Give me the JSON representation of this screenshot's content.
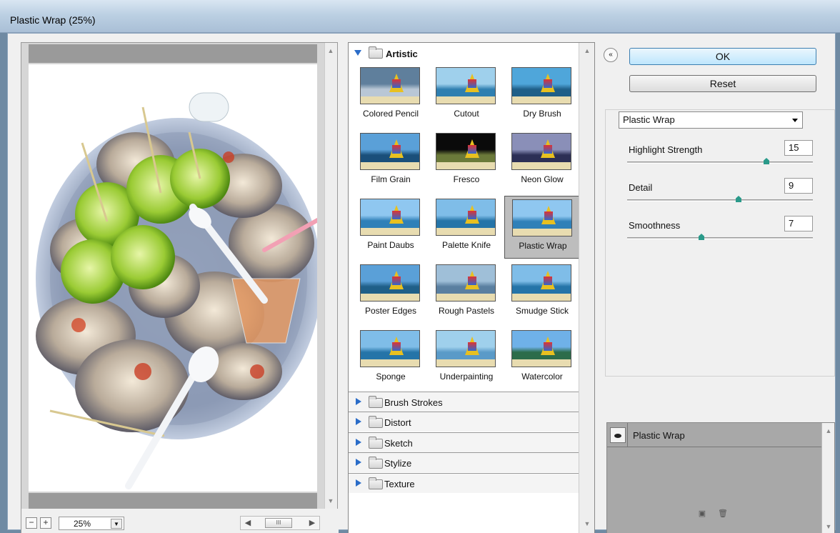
{
  "window": {
    "title": "Plastic Wrap (25%)"
  },
  "preview": {
    "zoom_value": "25%",
    "zoom_out_label": "−",
    "zoom_in_label": "+",
    "hscroll_thumb": "III"
  },
  "gallery": {
    "open_category": "Artistic",
    "filters": [
      {
        "label": "Colored Pencil"
      },
      {
        "label": "Cutout"
      },
      {
        "label": "Dry Brush"
      },
      {
        "label": "Film Grain"
      },
      {
        "label": "Fresco"
      },
      {
        "label": "Neon Glow"
      },
      {
        "label": "Paint Daubs"
      },
      {
        "label": "Palette Knife"
      },
      {
        "label": "Plastic Wrap"
      },
      {
        "label": "Poster Edges"
      },
      {
        "label": "Rough Pastels"
      },
      {
        "label": "Smudge Stick"
      },
      {
        "label": "Sponge"
      },
      {
        "label": "Underpainting"
      },
      {
        "label": "Watercolor"
      }
    ],
    "selected_filter": "Plastic Wrap",
    "collapsed_categories": [
      {
        "label": "Brush Strokes"
      },
      {
        "label": "Distort"
      },
      {
        "label": "Sketch"
      },
      {
        "label": "Stylize"
      },
      {
        "label": "Texture"
      }
    ]
  },
  "actions": {
    "ok_label": "OK",
    "reset_label": "Reset",
    "collapse_label": "«"
  },
  "settings": {
    "selected_filter": "Plastic Wrap",
    "params": [
      {
        "label": "Highlight Strength",
        "value": "15",
        "level": 0.75
      },
      {
        "label": "Detail",
        "value": "9",
        "level": 0.6
      },
      {
        "label": "Smoothness",
        "value": "7",
        "level": 0.4
      }
    ]
  },
  "layers": {
    "items": [
      {
        "label": "Plastic Wrap"
      }
    ]
  }
}
